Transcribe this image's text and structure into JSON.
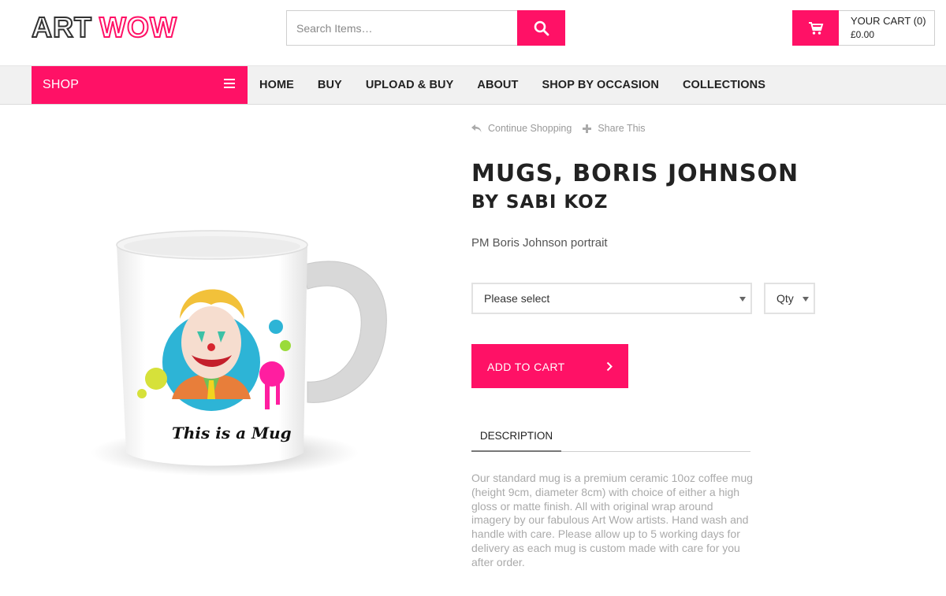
{
  "brand": {
    "logo_text_a": "ART",
    "logo_text_b": "WOW",
    "accent": "#ff1166"
  },
  "search": {
    "placeholder": "Search Items…",
    "icon": "search-icon"
  },
  "cart": {
    "title": "YOUR CART (0)",
    "total": "£0.00",
    "icon": "cart-icon"
  },
  "nav": {
    "shop_label": "SHOP",
    "items": [
      "HOME",
      "BUY",
      "UPLOAD & BUY",
      "ABOUT",
      "SHOP BY OCCASION",
      "COLLECTIONS"
    ]
  },
  "product": {
    "actions": {
      "continue": "Continue Shopping",
      "share": "Share This"
    },
    "title": "MUGS, BORIS JOHNSON",
    "artist": "BY SABI KOZ",
    "subtitle": "PM Boris Johnson portrait",
    "options": {
      "select_value": "Please select",
      "qty_value": "Qty"
    },
    "add_to_cart": "ADD TO CART",
    "tab_description": "DESCRIPTION",
    "description": "Our standard mug is a premium ceramic 10oz coffee mug (height 9cm, diameter 8cm) with choice of either a high gloss or matte finish. All with original wrap around imagery by our fabulous Art Wow artists. Hand wash and handle with care. Please allow up to 5 working days for delivery as each mug is custom made with care for you after order.",
    "mug_caption": "This is a Mug"
  }
}
